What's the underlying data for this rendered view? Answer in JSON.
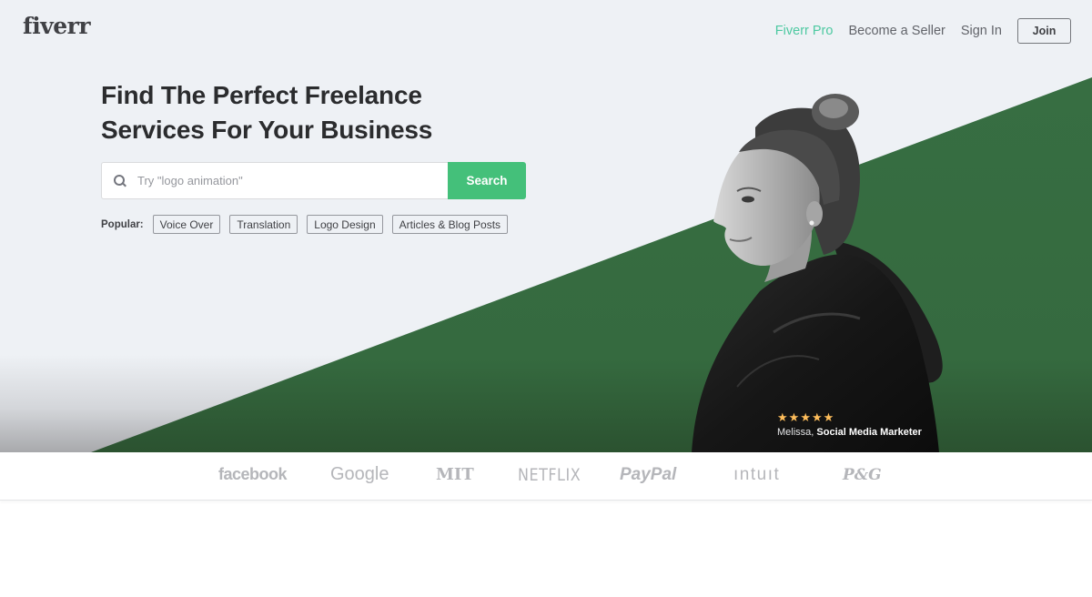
{
  "colors": {
    "hero_bg": "#eef1f5",
    "green_panel": "#356a3f",
    "accent_pro": "#4dc9a1",
    "search_button": "#44c07a",
    "star": "#ffbe5b"
  },
  "header": {
    "logo": "fiverr",
    "nav": [
      {
        "label": "Fiverr Pro"
      },
      {
        "label": "Become a Seller"
      },
      {
        "label": "Sign In"
      }
    ],
    "join_label": "Join"
  },
  "hero": {
    "headline_line1": "Find The Perfect Freelance",
    "headline_line2": "Services For Your Business",
    "search": {
      "placeholder": "Try \"logo animation\"",
      "value": "",
      "button_label": "Search",
      "icon": "search-icon"
    },
    "popular": {
      "label": "Popular:",
      "tags": [
        "Voice Over",
        "Translation",
        "Logo Design",
        "Articles & Blog Posts"
      ]
    },
    "testimonial": {
      "rating": 5,
      "rating_max": 5,
      "stars": [
        "★",
        "★",
        "★",
        "★",
        "★"
      ],
      "name": "Melissa,",
      "role": "Social Media Marketer"
    }
  },
  "trusted_by": {
    "logos": [
      "facebook",
      "Google",
      "MIT",
      "NETFLIX",
      "PayPal",
      "ıntuıt",
      "P&G"
    ]
  }
}
